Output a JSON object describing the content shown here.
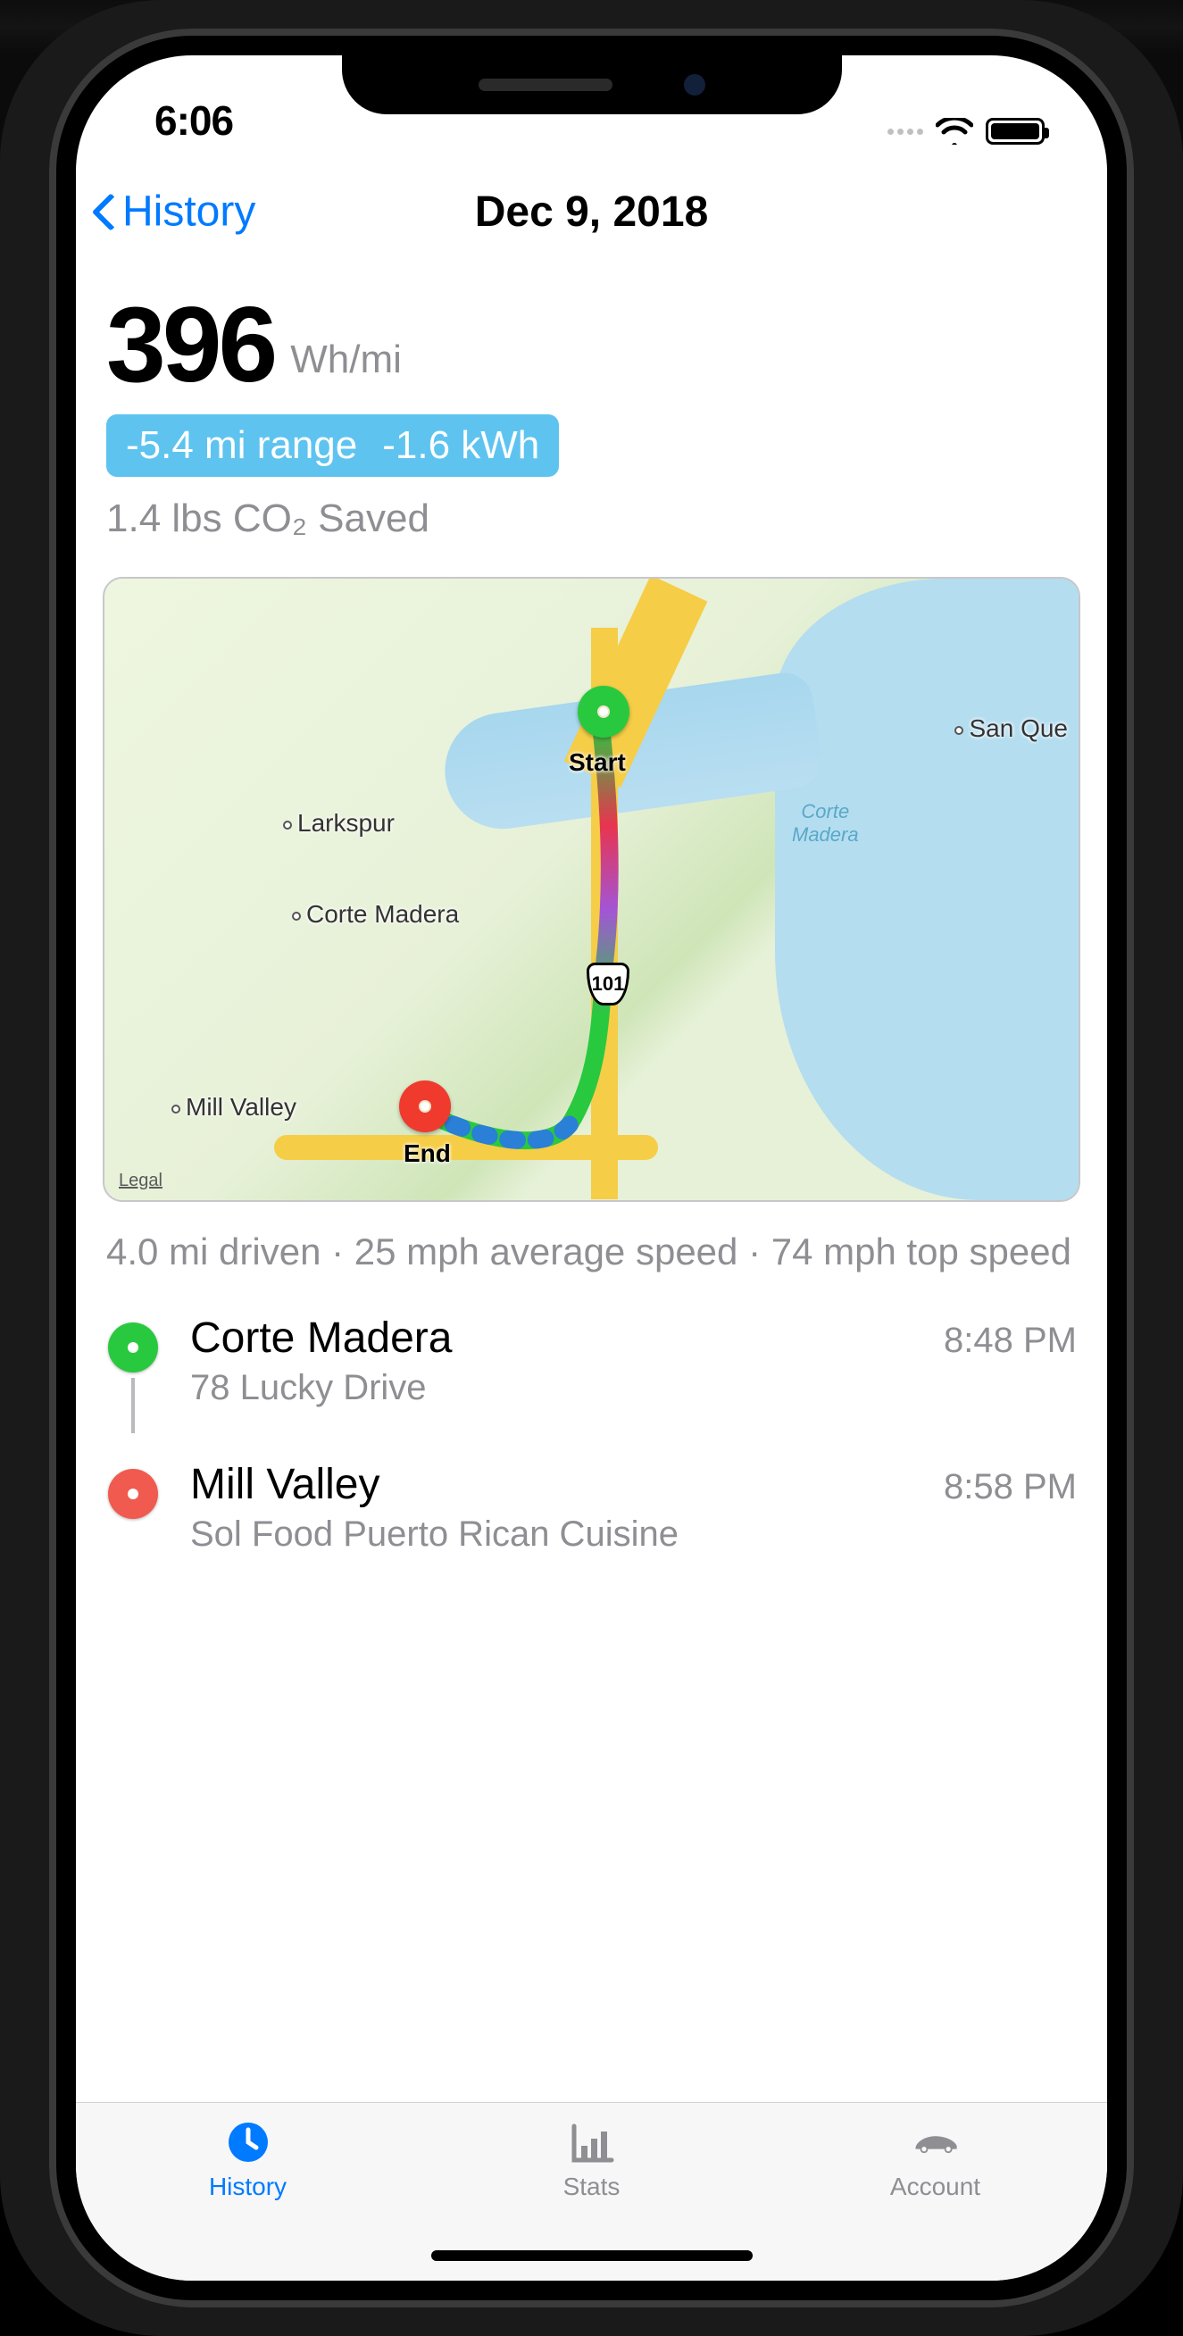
{
  "status_bar": {
    "time": "6:06"
  },
  "nav": {
    "back_label": "History",
    "title": "Dec 9, 2018"
  },
  "efficiency": {
    "value": "396",
    "unit": "Wh/mi",
    "range_delta": "-5.4 mi range",
    "energy_delta": "-1.6 kWh",
    "co2_saved": "1.4 lbs CO₂ Saved"
  },
  "map": {
    "start_label": "Start",
    "end_label": "End",
    "highway_shield": "101",
    "legal": "Legal",
    "cities": {
      "larkspur": "Larkspur",
      "corte_madera": "Corte Madera",
      "mill_valley": "Mill Valley",
      "san_que": "San Que"
    },
    "water": {
      "corte_madera": "Corte\nMadera"
    },
    "stats_line": "4.0 mi driven · 25 mph average speed · 74 mph top speed"
  },
  "waypoints": [
    {
      "name": "Corte Madera",
      "address": "78 Lucky Drive",
      "time": "8:48 PM"
    },
    {
      "name": "Mill Valley",
      "address": "Sol Food Puerto Rican Cuisine",
      "time": "8:58 PM"
    }
  ],
  "tabs": [
    {
      "label": "History",
      "active": true
    },
    {
      "label": "Stats",
      "active": false
    },
    {
      "label": "Account",
      "active": false
    }
  ]
}
